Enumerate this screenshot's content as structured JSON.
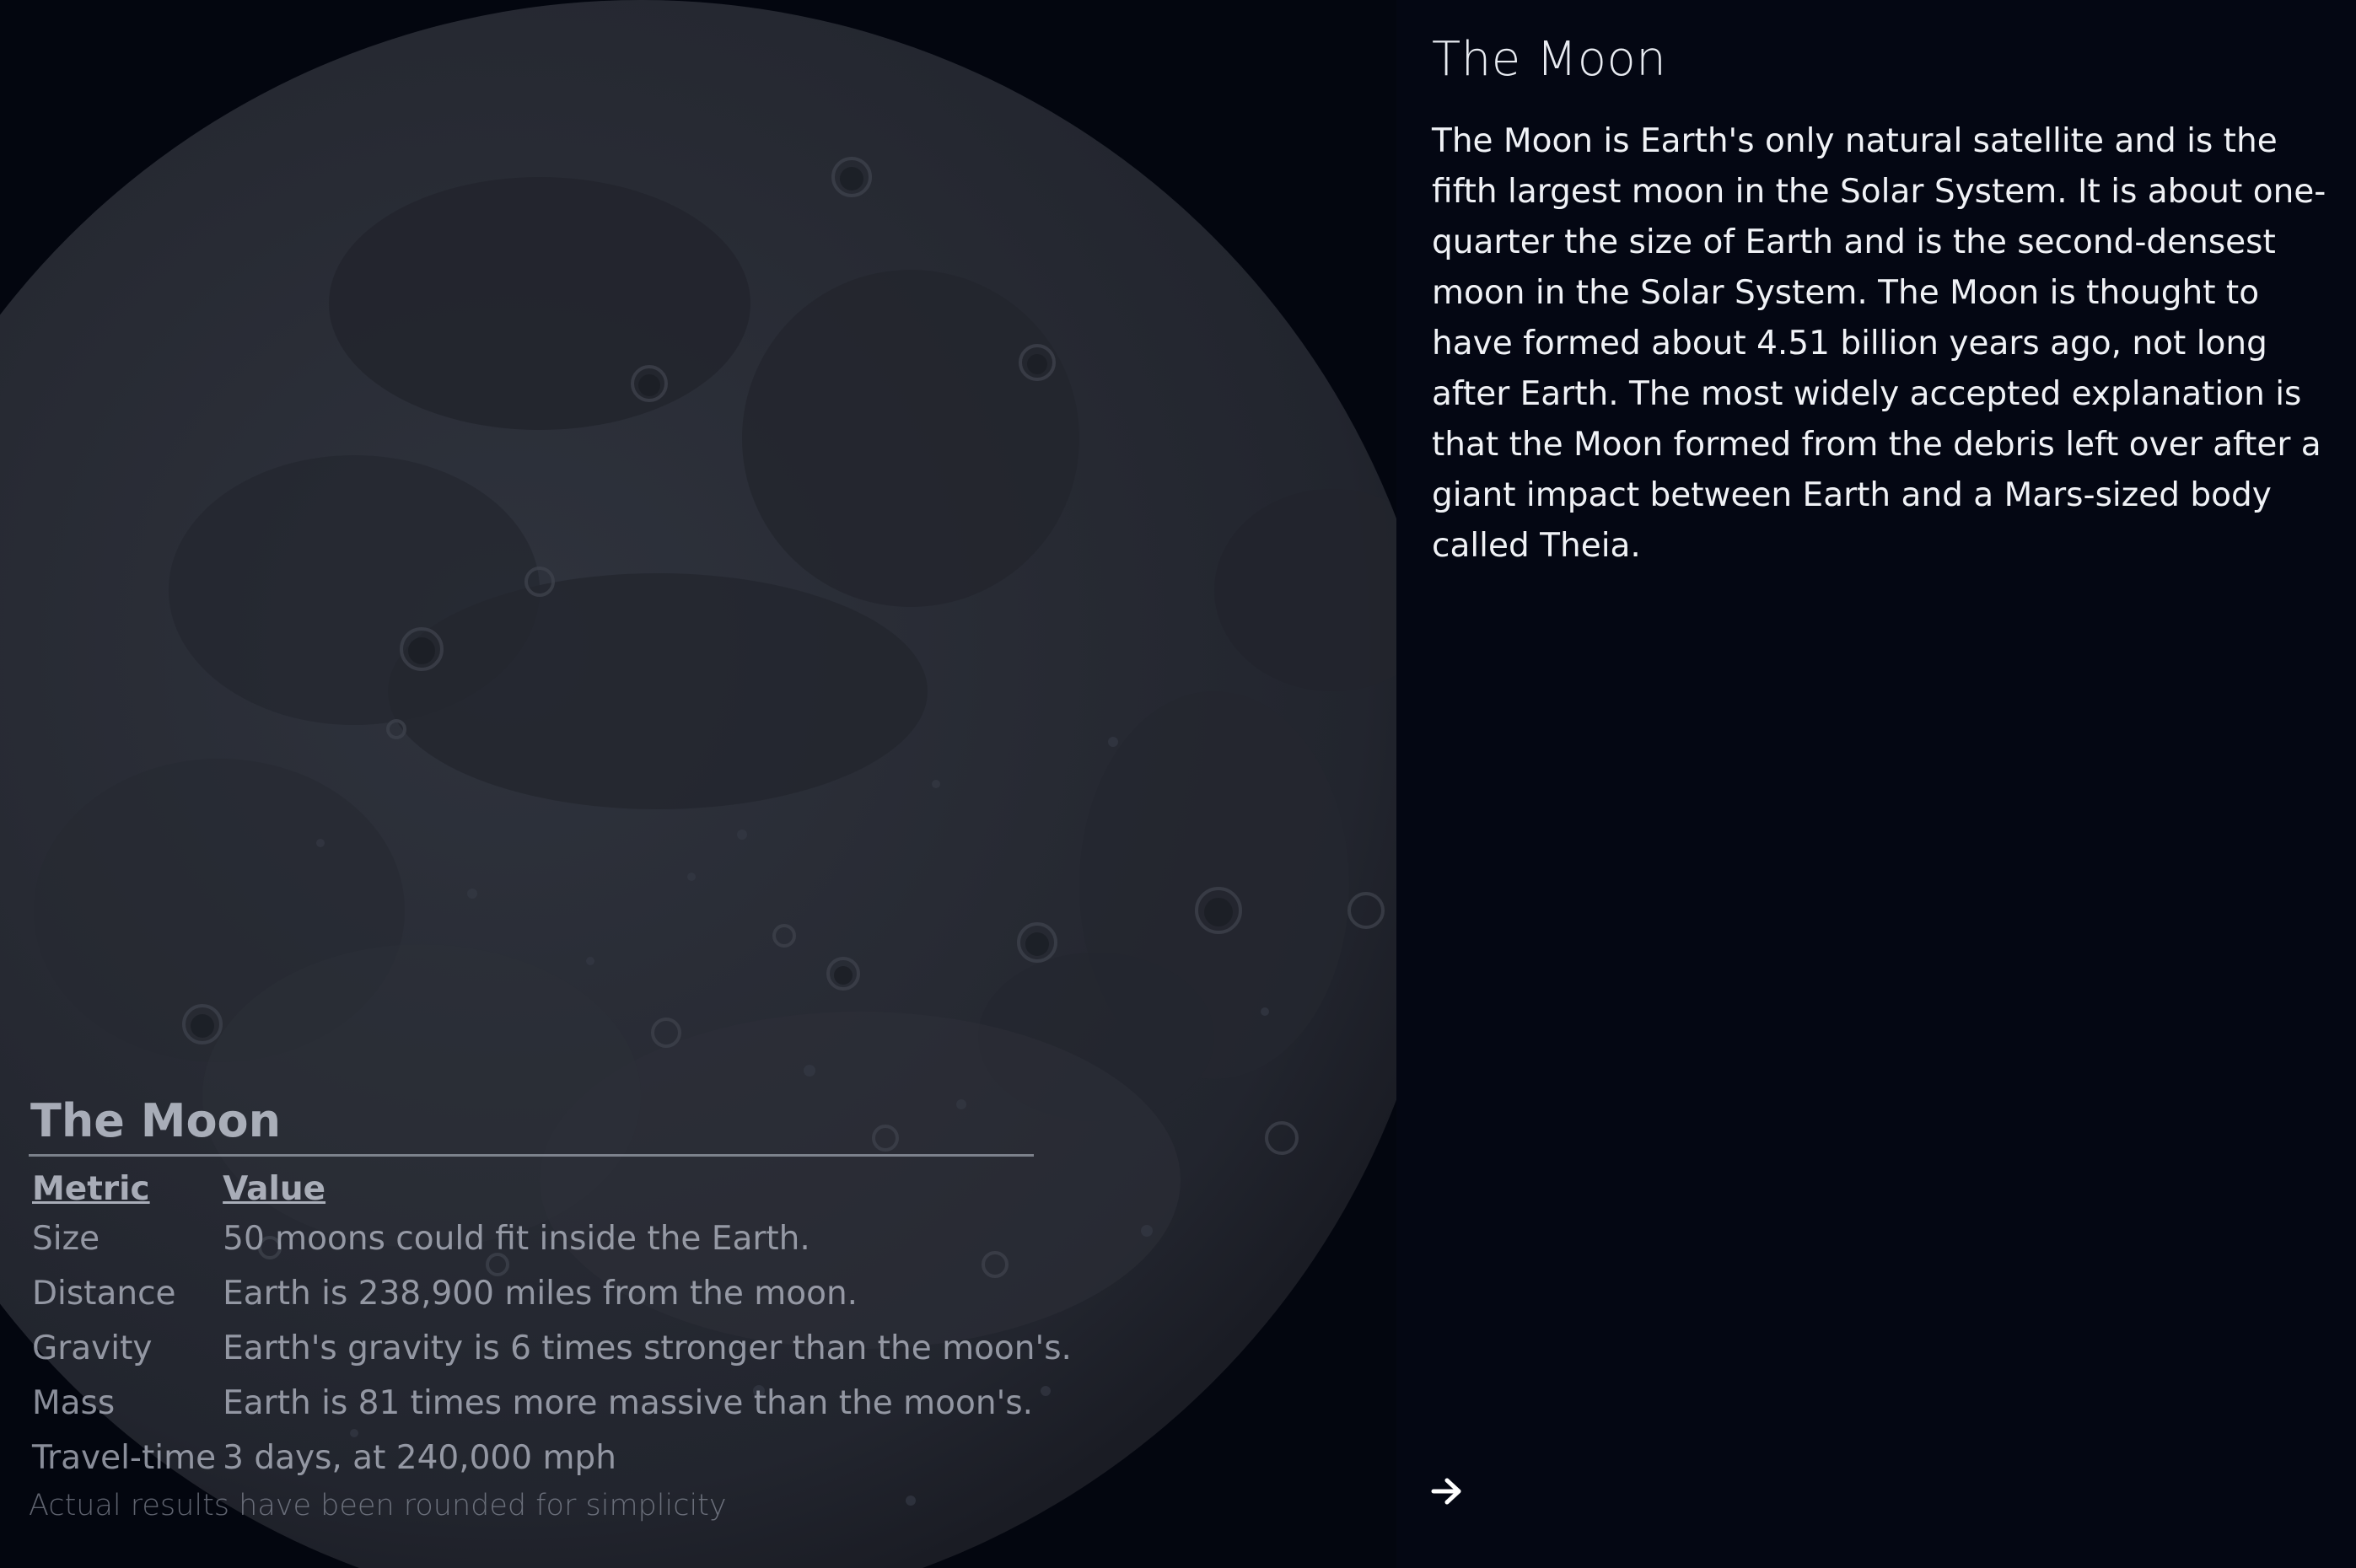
{
  "info_panel": {
    "title": "The Moon",
    "description": "The Moon is Earth's only natural satellite and is the fifth largest moon in the Solar System. It is about one-quarter the size of Earth and is the second-densest moon in the Solar System. The Moon is thought to have formed about 4.51 billion years ago, not long after Earth. The most widely accepted explanation is that the Moon formed from the debris left over after a giant impact between Earth and a Mars-sized body called Theia.",
    "next_icon": "arrow-right-icon"
  },
  "facts_table": {
    "title": "The Moon",
    "headers": {
      "metric": "Metric",
      "value": "Value"
    },
    "rows": [
      {
        "metric": "Size",
        "value": "50 moons could fit inside the Earth."
      },
      {
        "metric": "Distance",
        "value": "Earth is 238,900 miles from the moon."
      },
      {
        "metric": "Gravity",
        "value": "Earth's gravity is 6 times stronger than the moon's."
      },
      {
        "metric": "Mass",
        "value": "Earth is 81 times more massive than the moon's."
      },
      {
        "metric": "Travel-time",
        "value": "3 days, at 240,000 mph"
      }
    ],
    "footnote": "Actual results have been rounded for simplicity"
  },
  "colors": {
    "background": "#03060f",
    "moon_surface": "#2a2e38",
    "text_primary": "#f0f2f6"
  }
}
